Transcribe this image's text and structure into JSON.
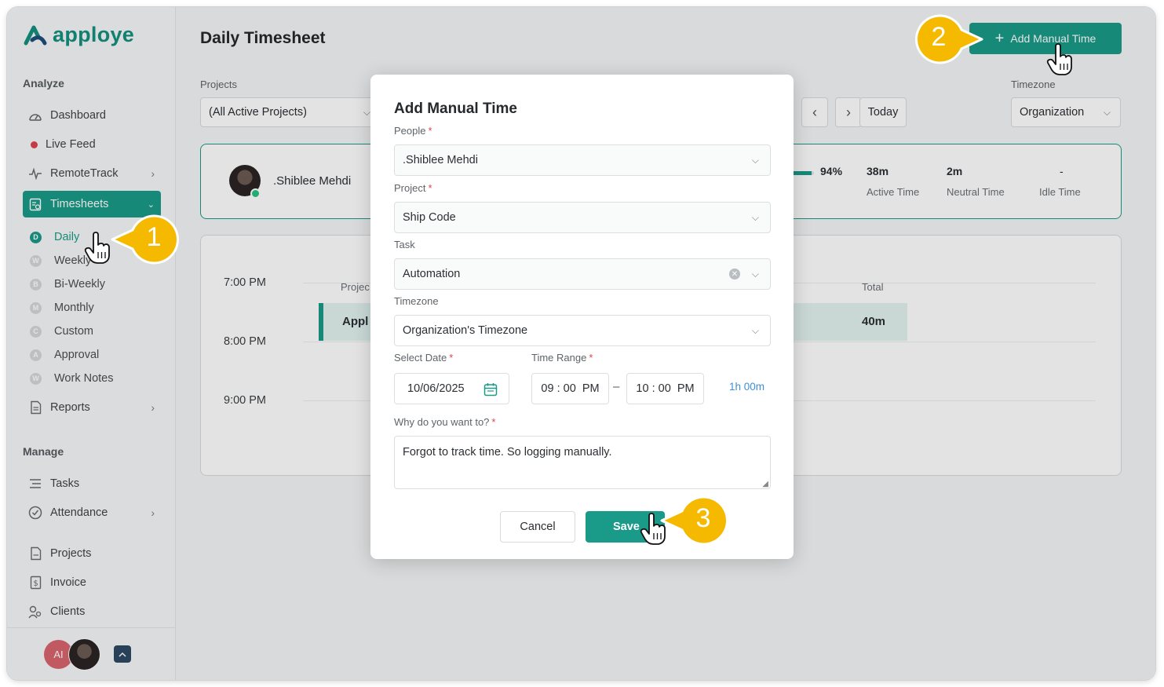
{
  "app": {
    "name": "apploye"
  },
  "sidebar": {
    "analyze_label": "Analyze",
    "manage_label": "Manage",
    "items": [
      {
        "label": "Dashboard",
        "icon": "dashboard-icon"
      },
      {
        "label": "Live Feed",
        "icon": "live-dot-icon"
      },
      {
        "label": "RemoteTrack",
        "icon": "pulse-icon"
      },
      {
        "label": "Timesheets",
        "icon": "timesheet-icon"
      },
      {
        "label": "Reports",
        "icon": "document-icon"
      }
    ],
    "timesheet_sub": [
      {
        "label": "Daily",
        "badge": "D"
      },
      {
        "label": "Weekly",
        "badge": "W"
      },
      {
        "label": "Bi-Weekly",
        "badge": "B"
      },
      {
        "label": "Monthly",
        "badge": "M"
      },
      {
        "label": "Custom",
        "badge": "C"
      },
      {
        "label": "Approval",
        "badge": "A"
      },
      {
        "label": "Work Notes",
        "badge": "W"
      }
    ],
    "manage_items": [
      {
        "label": "Tasks",
        "icon": "list-icon"
      },
      {
        "label": "Attendance",
        "icon": "check-circle-icon"
      },
      {
        "label": "Projects",
        "icon": "file-icon"
      },
      {
        "label": "Invoice",
        "icon": "invoice-icon"
      },
      {
        "label": "Clients",
        "icon": "users-icon"
      }
    ],
    "user_initials": "AI"
  },
  "header": {
    "title": "Daily Timesheet",
    "add_button": "Add Manual Time"
  },
  "filters": {
    "projects_label": "Projects",
    "projects_value": "(All Active Projects)",
    "today": "Today",
    "timezone_label": "Timezone",
    "timezone_value": "Organization"
  },
  "summary": {
    "user_name": ".Shiblee Mehdi",
    "percent": "94%",
    "active_value": "38m",
    "active_label": "Active Time",
    "neutral_value": "2m",
    "neutral_label": "Neutral Time",
    "idle_value": "-",
    "idle_label": "Idle Time"
  },
  "timeline": {
    "times": [
      "7:00 PM",
      "8:00 PM",
      "9:00 PM"
    ],
    "project_header": "Projec",
    "total_header": "Total",
    "entry_project": "Appl",
    "entry_total": "40m"
  },
  "modal": {
    "title": "Add Manual Time",
    "people_label": "People",
    "people_value": ".Shiblee Mehdi",
    "project_label": "Project",
    "project_value": "Ship Code",
    "task_label": "Task",
    "task_value": "Automation",
    "timezone_label": "Timezone",
    "timezone_value": "Organization's Timezone",
    "date_label": "Select Date",
    "date_value": "10/06/2025",
    "range_label": "Time Range",
    "start_time": "09 : 00  PM",
    "end_time": "10 : 00  PM",
    "dash": "–",
    "duration": "1h 00m",
    "reason_label": "Why do you want to?",
    "reason_value": "Forgot to track time. So logging manually.",
    "cancel": "Cancel",
    "save": "Save",
    "required_mark": "*"
  },
  "callouts": [
    "1",
    "2",
    "3"
  ],
  "colors": {
    "accent": "#1a9a88",
    "callout": "#f5b900",
    "required": "#e0434e"
  }
}
